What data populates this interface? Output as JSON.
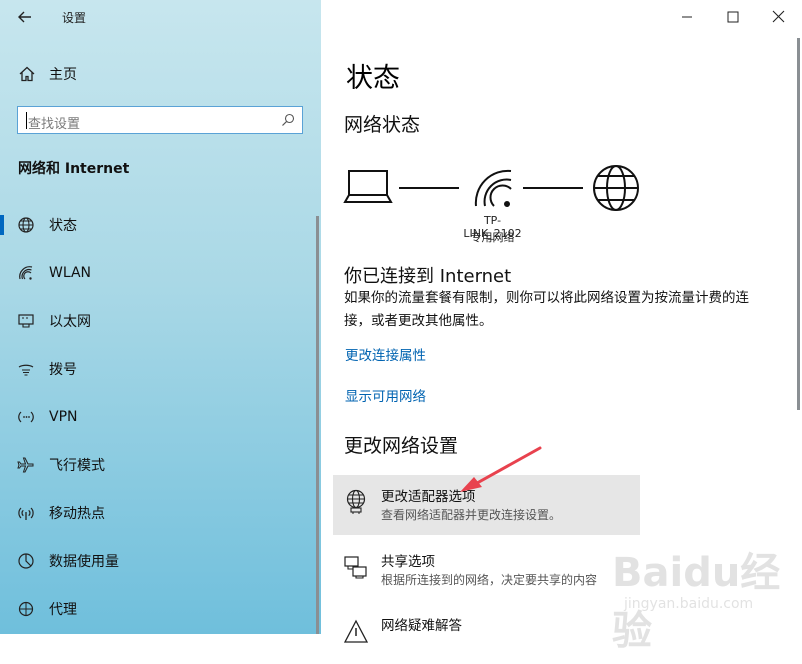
{
  "window": {
    "title": "设置"
  },
  "sidebar": {
    "home_label": "主页",
    "search_placeholder": "查找设置",
    "section_title": "网络和 Internet",
    "items": [
      {
        "label": "状态",
        "icon": "globe-icon",
        "selected": true
      },
      {
        "label": "WLAN",
        "icon": "wifi-icon",
        "selected": false
      },
      {
        "label": "以太网",
        "icon": "ethernet-icon",
        "selected": false
      },
      {
        "label": "拨号",
        "icon": "dialup-icon",
        "selected": false
      },
      {
        "label": "VPN",
        "icon": "vpn-icon",
        "selected": false
      },
      {
        "label": "飞行模式",
        "icon": "airplane-icon",
        "selected": false
      },
      {
        "label": "移动热点",
        "icon": "hotspot-icon",
        "selected": false
      },
      {
        "label": "数据使用量",
        "icon": "data-usage-icon",
        "selected": false
      },
      {
        "label": "代理",
        "icon": "proxy-icon",
        "selected": false
      }
    ]
  },
  "main": {
    "title": "状态",
    "network_status_heading": "网络状态",
    "network_name": "TP-LINK_2102",
    "network_type": "专用网络",
    "connected_text": "你已连接到 Internet",
    "description": "如果你的流量套餐有限制，则你可以将此网络设置为按流量计费的连接，或者更改其他属性。",
    "links": {
      "change_properties": "更改连接属性",
      "show_networks": "显示可用网络"
    },
    "change_settings_heading": "更改网络设置",
    "options": [
      {
        "title": "更改适配器选项",
        "subtitle": "查看网络适配器并更改连接设置。",
        "icon": "adapter-globe-icon"
      },
      {
        "title": "共享选项",
        "subtitle": "根据所连接到的网络，决定要共享的内容",
        "icon": "sharing-icon"
      },
      {
        "title": "网络疑难解答",
        "subtitle": "",
        "icon": "warning-icon"
      }
    ]
  },
  "watermark": {
    "logo": "Baidu经验",
    "url": "jingyan.baidu.com"
  },
  "colors": {
    "accent": "#0067c0",
    "link": "#0063b1",
    "arrow": "#e8424e"
  }
}
